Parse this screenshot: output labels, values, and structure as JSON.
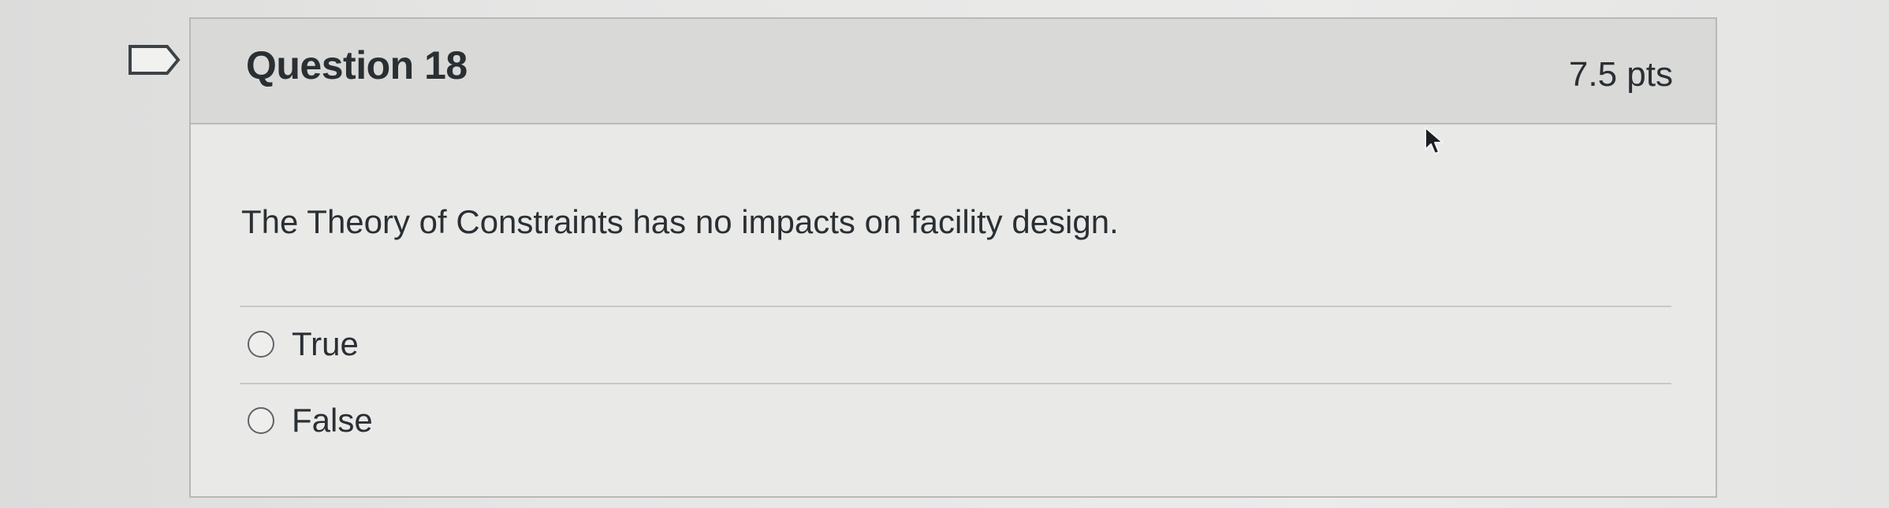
{
  "question": {
    "title": "Question 18",
    "points": "7.5 pts",
    "text": "The Theory of Constraints has no impacts on facility design.",
    "answers": [
      {
        "label": "True",
        "selected": false
      },
      {
        "label": "False",
        "selected": false
      }
    ]
  },
  "icons": {
    "flag": "flag-outline-icon",
    "cursor": "mouse-pointer-icon"
  },
  "colors": {
    "header_bg": "#d9dad8",
    "card_bg": "#e9eae8",
    "text": "#2a2f33",
    "border": "#b7b9b8"
  }
}
